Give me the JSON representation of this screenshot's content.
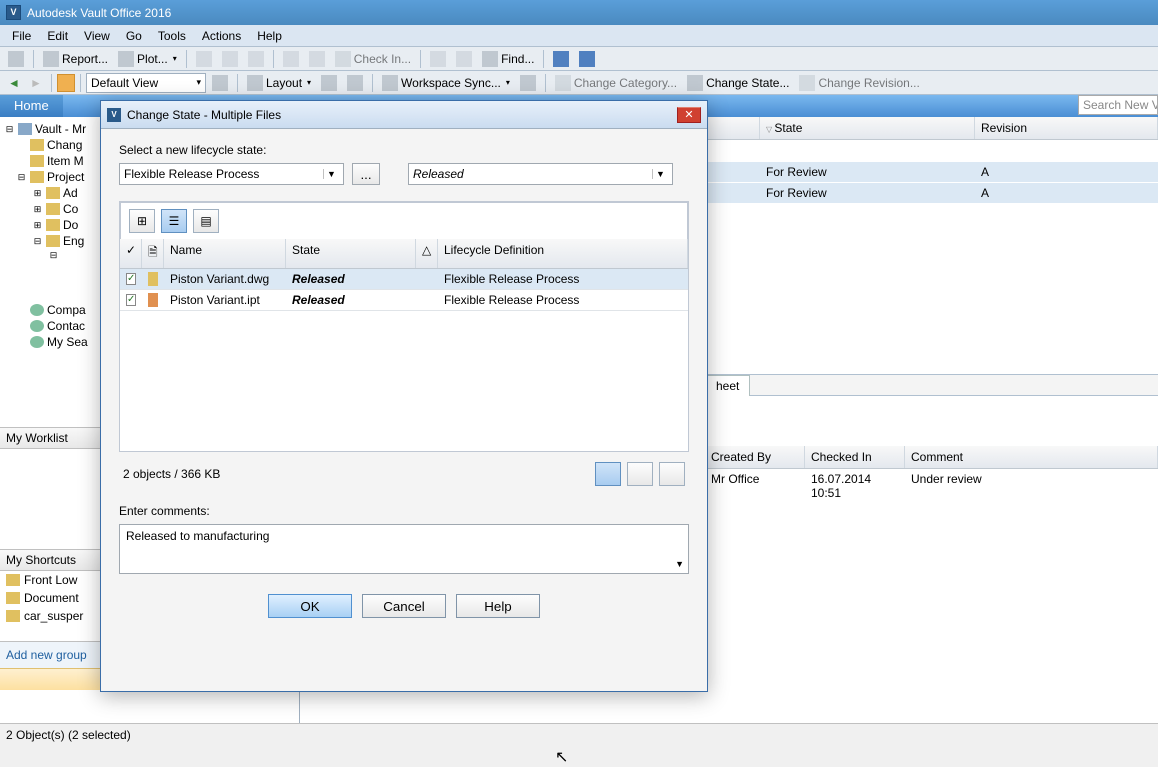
{
  "app": {
    "title": "Autodesk Vault Office 2016"
  },
  "menu": [
    "File",
    "Edit",
    "View",
    "Go",
    "Tools",
    "Actions",
    "Help"
  ],
  "toolbar1": {
    "report": "Report...",
    "plot": "Plot...",
    "checkin": "Check In...",
    "find": "Find..."
  },
  "toolbar2": {
    "view": "Default View",
    "layout": "Layout",
    "workspace": "Workspace Sync...",
    "change_category": "Change Category...",
    "change_state": "Change State...",
    "change_revision": "Change Revision..."
  },
  "home_tab": "Home",
  "search_placeholder": "Search New Va",
  "tree": {
    "root": "Vault - Mr",
    "items": [
      "Chang",
      "Item M",
      "Project",
      "Ad",
      "Co",
      "Do",
      "Eng"
    ],
    "searches": [
      "Compa",
      "Contac",
      "My Sea"
    ]
  },
  "worklist_hdr": "My Worklist",
  "shortcuts_hdr": "My Shortcuts",
  "shortcuts": [
    "Front Low",
    "Document",
    "car_susper"
  ],
  "add_group": "Add new group",
  "main_grid": {
    "cols": {
      "state": "State",
      "revision": "Revision"
    },
    "rows": [
      {
        "state": "For Review",
        "revision": "A"
      },
      {
        "state": "For Review",
        "revision": "A"
      }
    ]
  },
  "detail_tab": "heet",
  "detail_cols": {
    "createdby": "Created By",
    "checkedin": "Checked In",
    "comment": "Comment"
  },
  "detail_row": {
    "createdby": "Mr Office",
    "checkedin": "16.07.2014 10:51",
    "comment": "Under review"
  },
  "status": "2 Object(s) (2 selected)",
  "dialog": {
    "title": "Change State - Multiple Files",
    "label_select": "Select a new lifecycle state:",
    "lifecycle": "Flexible Release Process",
    "state": "Released",
    "ellipsis": "...",
    "grid": {
      "cols": {
        "chk": "✓",
        "name": "Name",
        "state": "State",
        "warn": "△",
        "def": "Lifecycle Definition"
      },
      "rows": [
        {
          "name": "Piston Variant.dwg",
          "state": "Released",
          "def": "Flexible Release Process"
        },
        {
          "name": "Piston Variant.ipt",
          "state": "Released",
          "def": "Flexible Release Process"
        }
      ]
    },
    "summary": "2 objects / 366 KB",
    "comments_label": "Enter comments:",
    "comments_value": "Released to manufacturing",
    "buttons": {
      "ok": "OK",
      "cancel": "Cancel",
      "help": "Help"
    }
  }
}
